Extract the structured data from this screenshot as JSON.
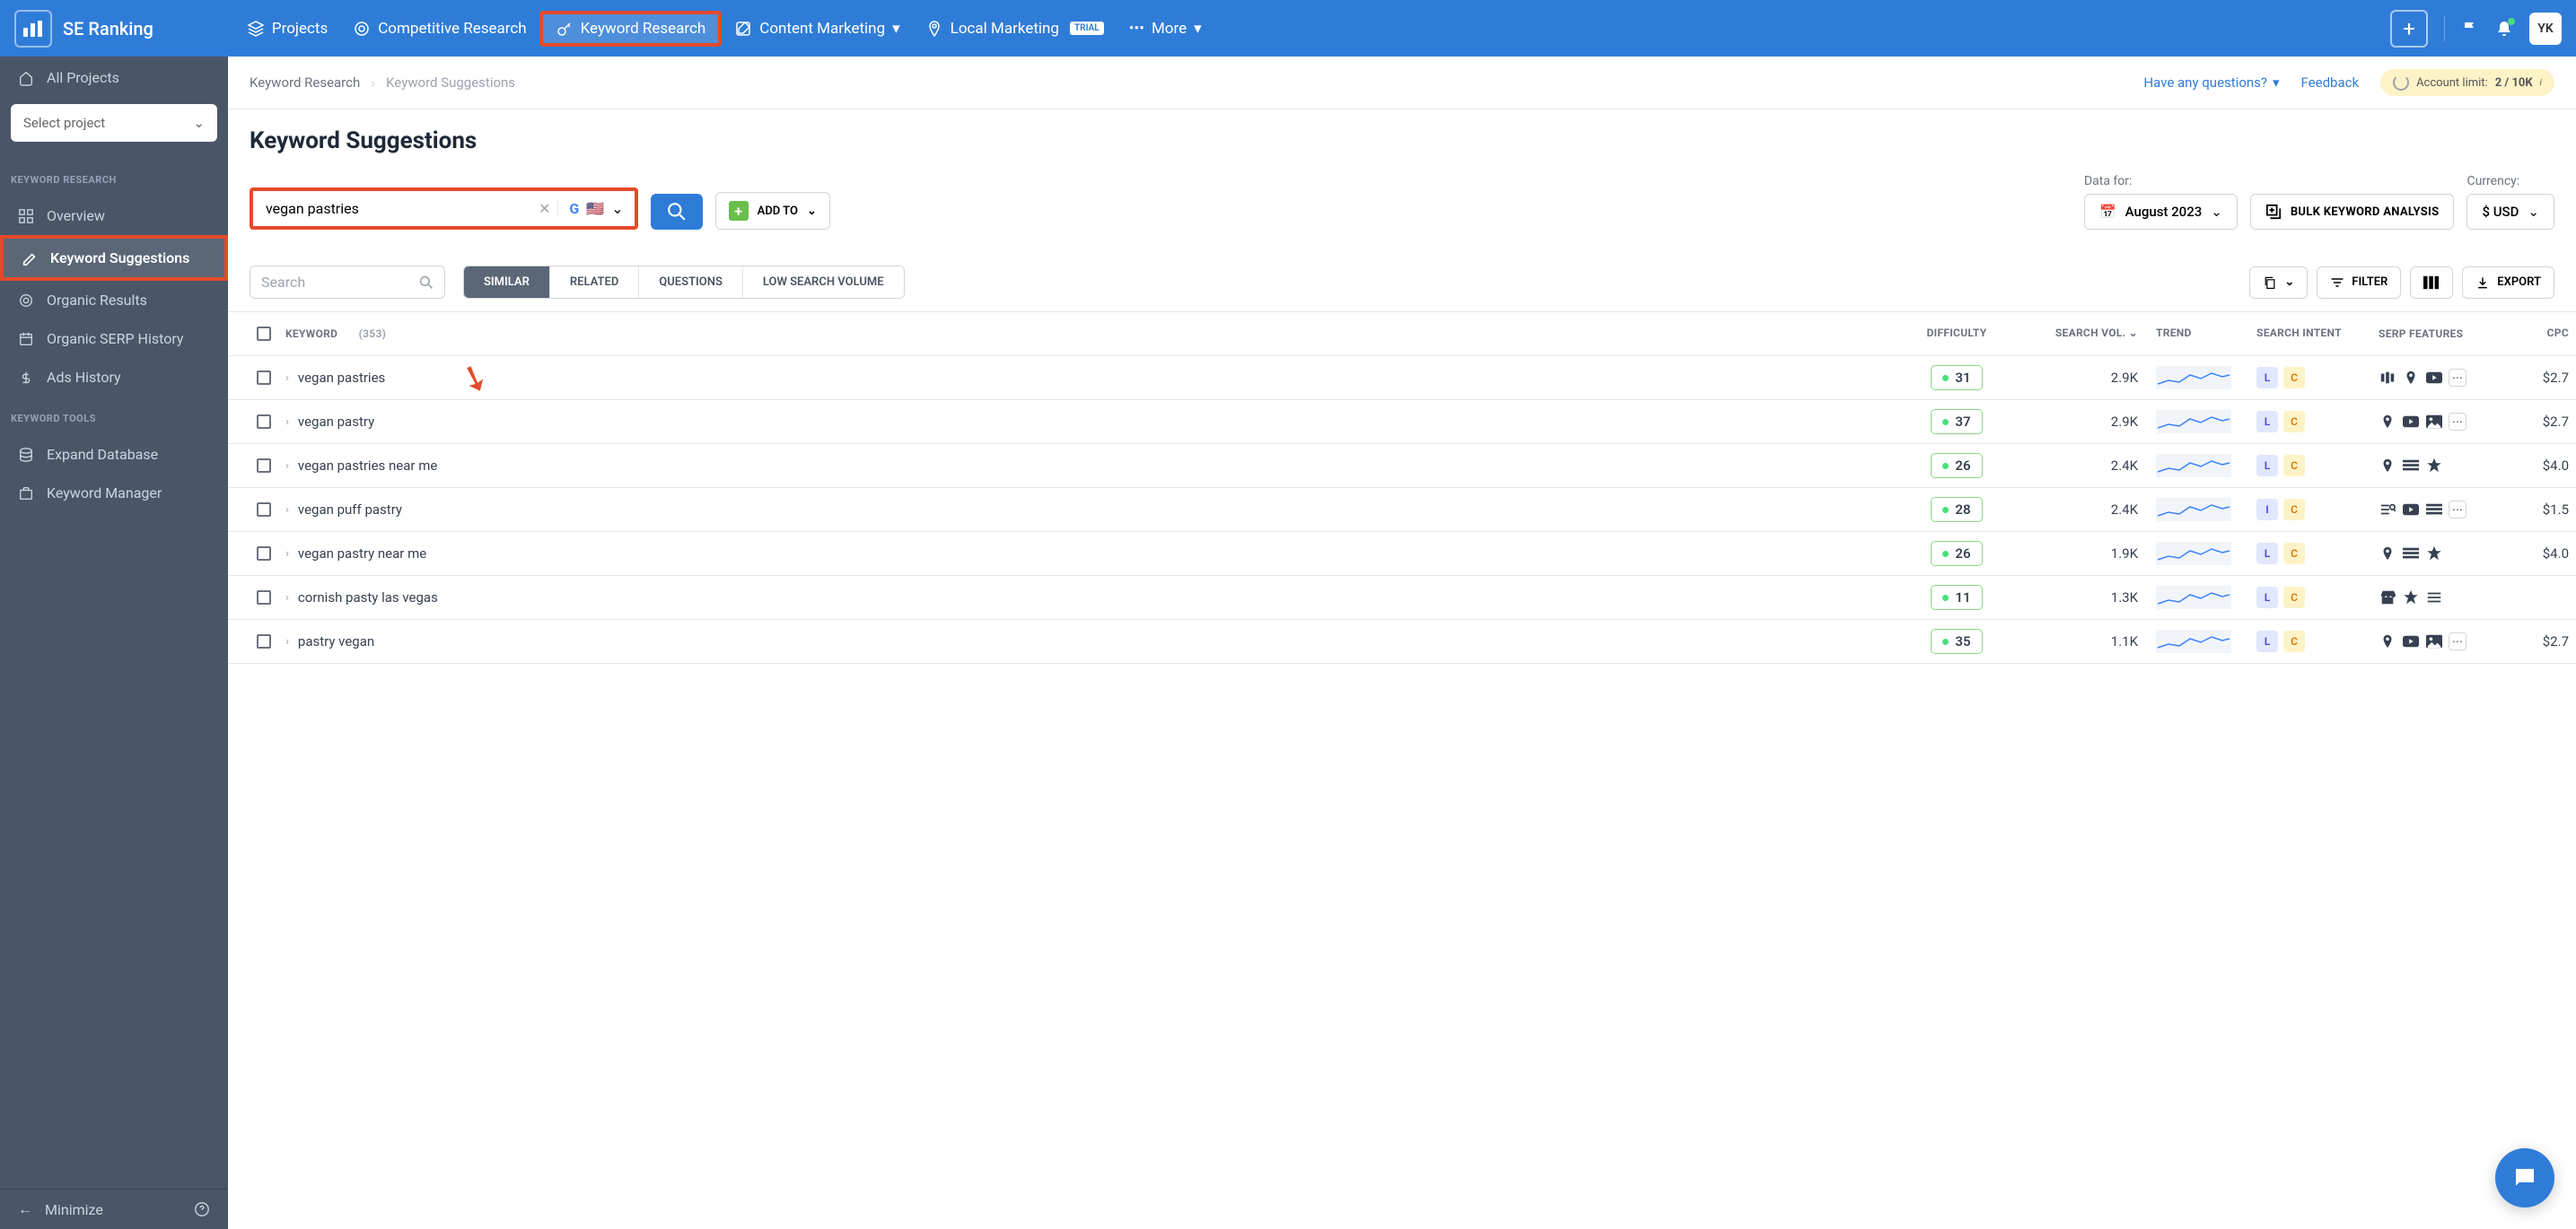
{
  "brand": "SE Ranking",
  "nav": {
    "projects": "Projects",
    "competitive": "Competitive Research",
    "keyword": "Keyword Research",
    "content": "Content Marketing",
    "local": "Local Marketing",
    "more": "More",
    "trial": "TRIAL"
  },
  "avatar": "YK",
  "sidebar": {
    "all_projects": "All Projects",
    "select_project": "Select project",
    "section1": "KEYWORD RESEARCH",
    "overview": "Overview",
    "suggestions": "Keyword Suggestions",
    "organic_results": "Organic Results",
    "organic_serp": "Organic SERP History",
    "ads_history": "Ads History",
    "section2": "KEYWORD TOOLS",
    "expand_db": "Expand Database",
    "kw_manager": "Keyword Manager",
    "minimize": "Minimize"
  },
  "breadcrumb": {
    "l1": "Keyword Research",
    "l2": "Keyword Suggestions",
    "questions": "Have any questions?",
    "feedback": "Feedback",
    "account_limit_label": "Account limit:",
    "account_limit_value": "2 / 10K"
  },
  "page": {
    "title": "Keyword Suggestions",
    "keyword_input": "vegan pastries",
    "add_to": "ADD TO",
    "data_for_label": "Data for:",
    "date": "August 2023",
    "bulk": "BULK KEYWORD ANALYSIS",
    "currency_label": "Currency:",
    "currency": "$ USD"
  },
  "table_ctrl": {
    "search": "Search",
    "similar": "SIMILAR",
    "related": "RELATED",
    "questions": "QUESTIONS",
    "low_vol": "LOW SEARCH VOLUME",
    "filter": "FILTER",
    "export": "EXPORT"
  },
  "columns": {
    "keyword": "KEYWORD",
    "count": "(353)",
    "difficulty": "DIFFICULTY",
    "search_vol": "SEARCH VOL.",
    "trend": "TREND",
    "intent": "SEARCH INTENT",
    "serp": "SERP FEATURES",
    "cpc": "CPC"
  },
  "rows": [
    {
      "kw": "vegan pastries",
      "diff": "31",
      "vol": "2.9K",
      "intent": [
        "L",
        "C"
      ],
      "serp": [
        "carousel",
        "pin",
        "video",
        "more"
      ],
      "cpc": "$2.7"
    },
    {
      "kw": "vegan pastry",
      "diff": "37",
      "vol": "2.9K",
      "intent": [
        "L",
        "C"
      ],
      "serp": [
        "pin",
        "video",
        "image",
        "more"
      ],
      "cpc": "$2.7"
    },
    {
      "kw": "vegan pastries near me",
      "diff": "26",
      "vol": "2.4K",
      "intent": [
        "L",
        "C"
      ],
      "serp": [
        "pin",
        "list",
        "star"
      ],
      "cpc": "$4.0"
    },
    {
      "kw": "vegan puff pastry",
      "diff": "28",
      "vol": "2.4K",
      "intent": [
        "I",
        "C"
      ],
      "serp": [
        "serp",
        "video",
        "list",
        "more"
      ],
      "cpc": "$1.5"
    },
    {
      "kw": "vegan pastry near me",
      "diff": "26",
      "vol": "1.9K",
      "intent": [
        "L",
        "C"
      ],
      "serp": [
        "pin",
        "list",
        "star"
      ],
      "cpc": "$4.0"
    },
    {
      "kw": "cornish pasty las vegas",
      "diff": "11",
      "vol": "1.3K",
      "intent": [
        "L",
        "C"
      ],
      "serp": [
        "shop",
        "star",
        "lines"
      ],
      "cpc": ""
    },
    {
      "kw": "pastry vegan",
      "diff": "35",
      "vol": "1.1K",
      "intent": [
        "L",
        "C"
      ],
      "serp": [
        "pin",
        "video",
        "image",
        "more"
      ],
      "cpc": "$2.7"
    }
  ]
}
